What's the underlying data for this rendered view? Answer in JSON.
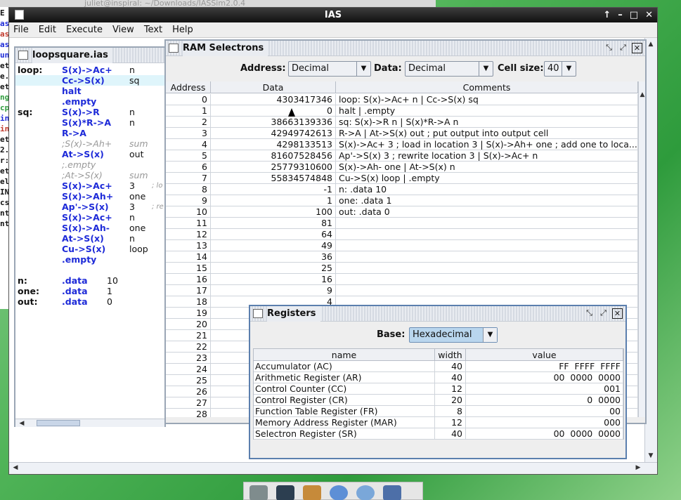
{
  "background_terminal": {
    "title": "juliet@inspiral: ~/Downloads/IASSim2.0.4",
    "left_chars": [
      "E",
      "as",
      "as",
      "as",
      "un",
      "et",
      "e.",
      "et",
      "ng",
      "cp",
      "in",
      "in",
      "et",
      "2.",
      "r:",
      "et",
      "el",
      "IN",
      "cs",
      "nt",
      "nt"
    ]
  },
  "window": {
    "title": "IAS",
    "controls": [
      "↑",
      "–",
      "□",
      "✕"
    ]
  },
  "menubar": [
    "File",
    "Edit",
    "Execute",
    "View",
    "Text",
    "Help"
  ],
  "code_frame": {
    "title": "loopsquare.ias",
    "lines": [
      {
        "label": "loop:",
        "ins": "S(x)->Ac+",
        "arg": "n",
        "cmt": "",
        "comment": false,
        "hl": false
      },
      {
        "label": "",
        "ins": "Cc->S(x)",
        "arg": "sq",
        "cmt": "",
        "comment": false,
        "hl": true
      },
      {
        "label": "",
        "ins": "halt",
        "arg": "",
        "cmt": "",
        "comment": false,
        "hl": false
      },
      {
        "label": "",
        "ins": ".empty",
        "arg": "",
        "cmt": "",
        "comment": false,
        "hl": false
      },
      {
        "label": "sq:",
        "ins": "S(x)->R",
        "arg": "n",
        "cmt": "",
        "comment": false,
        "hl": false
      },
      {
        "label": "",
        "ins": "S(x)*R->A",
        "arg": "n",
        "cmt": "",
        "comment": false,
        "hl": false
      },
      {
        "label": "",
        "ins": "R->A",
        "arg": "",
        "cmt": "",
        "comment": false,
        "hl": false
      },
      {
        "label": "",
        "ins": ";S(x)->Ah+",
        "arg": "sum",
        "cmt": "",
        "comment": true,
        "hl": false
      },
      {
        "label": "",
        "ins": "At->S(x)",
        "arg": "out",
        "cmt": "",
        "comment": false,
        "hl": false
      },
      {
        "label": "",
        "ins": ";.empty",
        "arg": "",
        "cmt": "",
        "comment": true,
        "hl": false
      },
      {
        "label": "",
        "ins": ";At->S(x)",
        "arg": "sum",
        "cmt": "",
        "comment": true,
        "hl": false
      },
      {
        "label": "",
        "ins": "S(x)->Ac+",
        "arg": "3",
        "cmt": "; lo",
        "comment": false,
        "hl": false
      },
      {
        "label": "",
        "ins": "S(x)->Ah+",
        "arg": "one",
        "cmt": "",
        "comment": false,
        "hl": false
      },
      {
        "label": "",
        "ins": "Ap'->S(x)",
        "arg": "3",
        "cmt": "; re",
        "comment": false,
        "hl": false
      },
      {
        "label": "",
        "ins": "S(x)->Ac+",
        "arg": "n",
        "cmt": "",
        "comment": false,
        "hl": false
      },
      {
        "label": "",
        "ins": "S(x)->Ah-",
        "arg": "one",
        "cmt": "",
        "comment": false,
        "hl": false
      },
      {
        "label": "",
        "ins": "At->S(x)",
        "arg": "n",
        "cmt": "",
        "comment": false,
        "hl": false
      },
      {
        "label": "",
        "ins": "Cu->S(x)",
        "arg": "loop",
        "cmt": "",
        "comment": false,
        "hl": false
      },
      {
        "label": "",
        "ins": ".empty",
        "arg": "",
        "cmt": "",
        "comment": false,
        "hl": false
      },
      {
        "label": "",
        "ins": "",
        "arg": "",
        "cmt": "",
        "comment": false,
        "hl": false
      },
      {
        "label": "n:",
        "ins": ".data",
        "arg": "10",
        "cmt": "",
        "comment": false,
        "hl": false
      },
      {
        "label": "one:",
        "ins": ".data",
        "arg": "1",
        "cmt": "",
        "comment": false,
        "hl": false
      },
      {
        "label": "out:",
        "ins": ".data",
        "arg": "0",
        "cmt": "",
        "comment": false,
        "hl": false
      }
    ]
  },
  "ram_frame": {
    "title": "RAM Selectrons",
    "address_label": "Address:",
    "address_value": "Decimal",
    "data_label": "Data:",
    "data_value": "Decimal",
    "cellsize_label": "Cell size:",
    "cellsize_value": "40",
    "columns": [
      "Address",
      "Data",
      "Comments"
    ],
    "rows": [
      [
        "0",
        "4303417346",
        "loop: S(x)->Ac+ n | Cc->S(x) sq"
      ],
      [
        "1",
        "0",
        "halt  | .empty"
      ],
      [
        "2",
        "38663139336",
        "sq: S(x)->R n | S(x)*R->A n"
      ],
      [
        "3",
        "42949742613",
        "R->A  | At->S(x) out ; put output into output cell"
      ],
      [
        "4",
        "4298133513",
        "S(x)->Ac+ 3 ; load in location 3 | S(x)->Ah+ one ; add one to loca..."
      ],
      [
        "5",
        "81607528456",
        "Ap'->S(x) 3 ; rewrite location 3 | S(x)->Ac+ n"
      ],
      [
        "6",
        "25779310600",
        "S(x)->Ah- one | At->S(x) n"
      ],
      [
        "7",
        "55834574848",
        "Cu->S(x) loop | .empty"
      ],
      [
        "8",
        "-1",
        "n: .data 10"
      ],
      [
        "9",
        "1",
        "one: .data 1"
      ],
      [
        "10",
        "100",
        "out: .data 0"
      ],
      [
        "11",
        "81",
        ""
      ],
      [
        "12",
        "64",
        ""
      ],
      [
        "13",
        "49",
        ""
      ],
      [
        "14",
        "36",
        ""
      ],
      [
        "15",
        "25",
        ""
      ],
      [
        "16",
        "16",
        ""
      ],
      [
        "17",
        "9",
        ""
      ],
      [
        "18",
        "4",
        ""
      ],
      [
        "19",
        "",
        ""
      ],
      [
        "20",
        "",
        ""
      ],
      [
        "21",
        "",
        ""
      ],
      [
        "22",
        "",
        ""
      ],
      [
        "23",
        "",
        ""
      ],
      [
        "24",
        "",
        ""
      ],
      [
        "25",
        "",
        ""
      ],
      [
        "26",
        "",
        ""
      ],
      [
        "27",
        "",
        ""
      ],
      [
        "28",
        "",
        ""
      ]
    ]
  },
  "registers_frame": {
    "title": "Registers",
    "base_label": "Base:",
    "base_value": "Hexadecimal",
    "columns": [
      "name",
      "width",
      "value"
    ],
    "rows": [
      [
        "Accumulator (AC)",
        "40",
        "FF  FFFF  FFFF"
      ],
      [
        "Arithmetic Register (AR)",
        "40",
        "00  0000  0000"
      ],
      [
        "Control Counter (CC)",
        "12",
        "001"
      ],
      [
        "Control Register (CR)",
        "20",
        "0  0000"
      ],
      [
        "Function Table Register (FR)",
        "8",
        "00"
      ],
      [
        "Memory Address Register (MAR)",
        "12",
        "000"
      ],
      [
        "Selectron Register (SR)",
        "40",
        "00  0000  0000"
      ]
    ]
  },
  "icons": [
    "window-icon",
    "minimize-icon",
    "maximize-icon",
    "close-icon",
    "dropdown-arrow-icon",
    "terminal-icon",
    "file-manager-icon",
    "browser-icon",
    "search-icon",
    "folder-icon"
  ]
}
